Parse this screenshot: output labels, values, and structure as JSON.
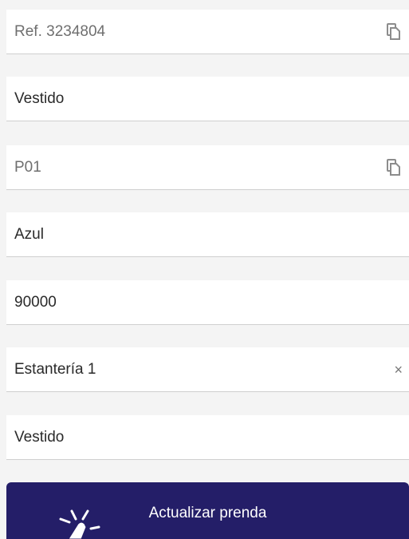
{
  "form": {
    "reference": {
      "value": "Ref. 3234804",
      "icon": "copy-icon"
    },
    "type": {
      "value": "Vestido"
    },
    "code": {
      "value": "P01",
      "icon": "copy-icon"
    },
    "color": {
      "value": "Azul"
    },
    "price": {
      "value": "90000"
    },
    "location": {
      "value": "Estantería 1",
      "clear_label": "×"
    },
    "category": {
      "value": "Vestido"
    },
    "submit_label": "Actualizar prenda"
  },
  "colors": {
    "accent": "#241e68",
    "background": "#f4f4f4",
    "field": "#ffffff"
  }
}
